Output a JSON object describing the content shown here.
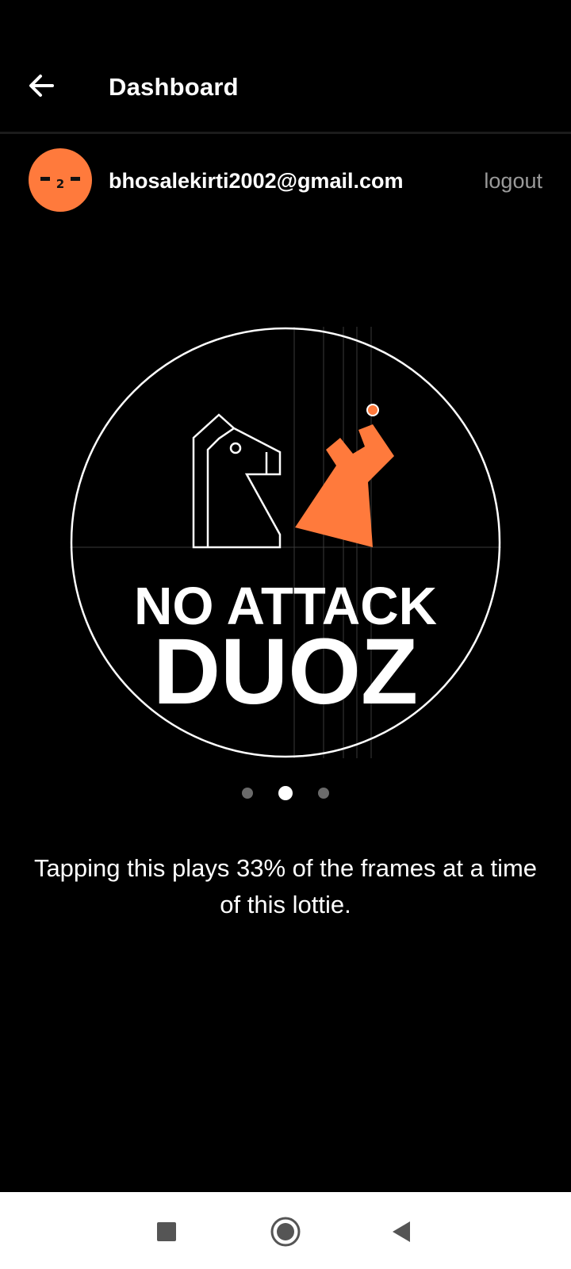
{
  "header": {
    "title": "Dashboard",
    "back_icon": "arrow-left-icon"
  },
  "account": {
    "email": "bhosalekirti2002@gmail.com",
    "logout_label": "logout",
    "avatar_color": "#ff7a3c"
  },
  "lottie": {
    "line1": "NO ATTACK",
    "line2": "DUOZ",
    "accent_color": "#ff7a3c"
  },
  "pager": {
    "count": 3,
    "active_index": 1
  },
  "description": "Tapping this plays 33% of the frames at a time of this lottie.",
  "system_nav": {
    "icons": [
      "recents-square-icon",
      "home-circle-icon",
      "back-triangle-icon"
    ]
  }
}
